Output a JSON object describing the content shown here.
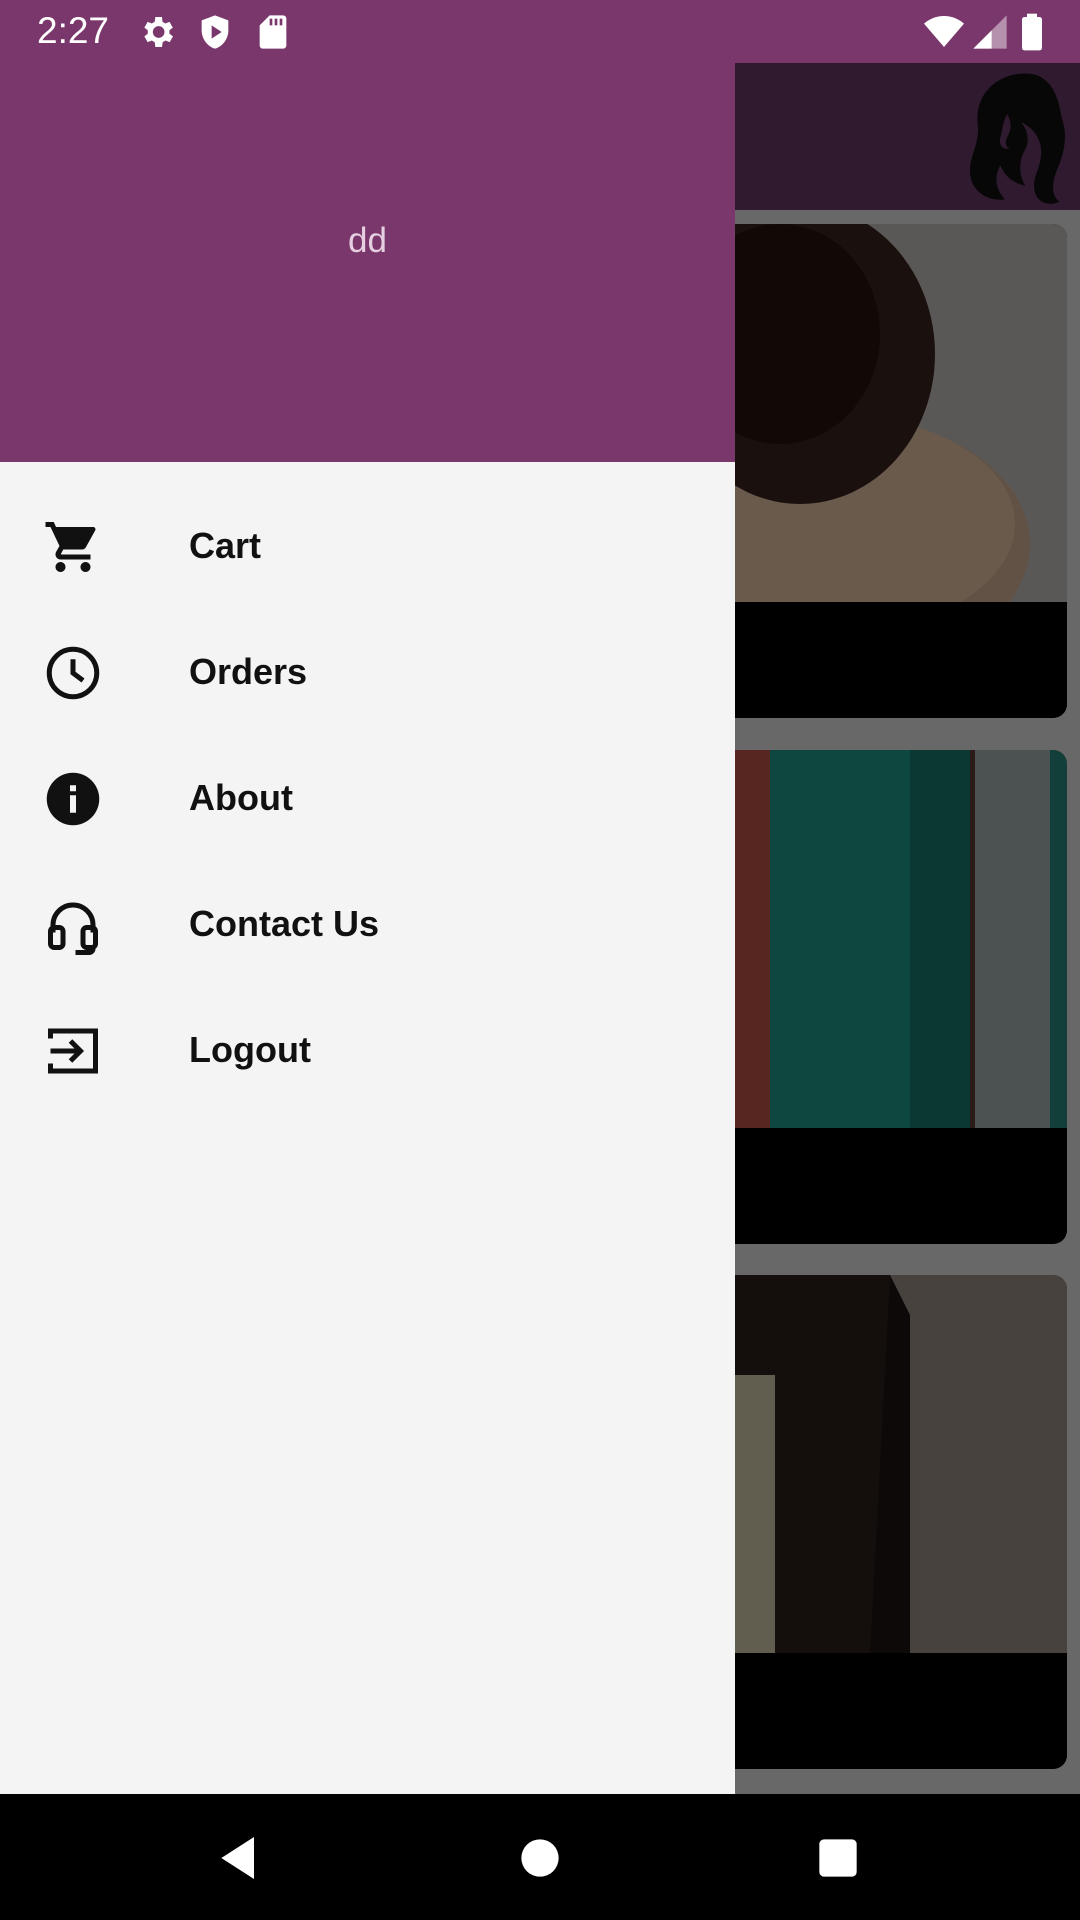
{
  "status_bar": {
    "time": "2:27",
    "left_icons": [
      "gear-icon",
      "shield-play-icon",
      "sd-card-icon"
    ],
    "right_icons": [
      "wifi-icon",
      "signal-icon",
      "battery-icon"
    ]
  },
  "drawer": {
    "header_color": "#7a376b",
    "user_name": "dd",
    "items": [
      {
        "label": "Cart",
        "icon": "cart-icon"
      },
      {
        "label": "Orders",
        "icon": "clock-icon"
      },
      {
        "label": "About",
        "icon": "info-icon"
      },
      {
        "label": "Contact Us",
        "icon": "headset-icon"
      },
      {
        "label": "Logout",
        "icon": "logout-icon"
      }
    ]
  },
  "background_app": {
    "appbar_color": "#6a3a6a",
    "logo_icon": "woman-hair-logo",
    "cards": [
      {
        "image": "makeup-brush-powder"
      },
      {
        "image": "cosmetic-tubes"
      },
      {
        "image": "dark-frame"
      }
    ]
  },
  "nav_bar": {
    "buttons": [
      "back-icon",
      "home-icon",
      "recents-icon"
    ]
  }
}
